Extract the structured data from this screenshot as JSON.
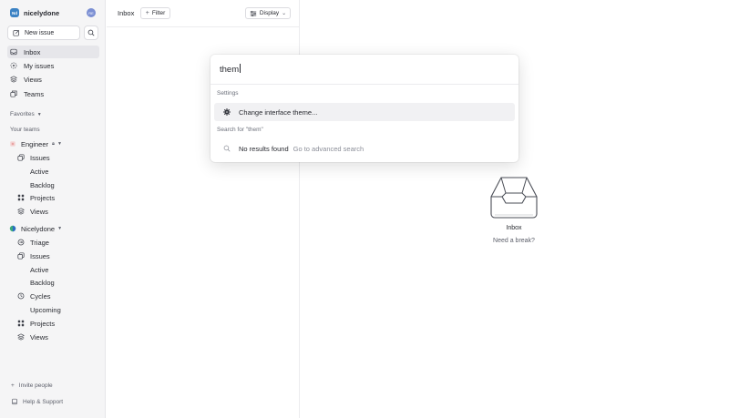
{
  "workspace": {
    "name": "nicelydone",
    "logo_text": "Nd",
    "avatar_text": "RE"
  },
  "sidebar": {
    "new_issue_label": "New issue",
    "nav": [
      {
        "label": "Inbox",
        "icon": "inbox-icon",
        "active": true
      },
      {
        "label": "My issues",
        "icon": "my-issues-icon"
      },
      {
        "label": "Views",
        "icon": "views-icon"
      },
      {
        "label": "Teams",
        "icon": "teams-icon"
      }
    ],
    "favorites_label": "Favorites",
    "your_teams_label": "Your teams",
    "teams": [
      {
        "name": "Engineer",
        "items": [
          {
            "label": "Issues",
            "icon": "issues-icon"
          },
          {
            "label": "Active",
            "nested": true
          },
          {
            "label": "Backlog",
            "nested": true
          },
          {
            "label": "Projects",
            "icon": "projects-icon"
          },
          {
            "label": "Views",
            "icon": "views-icon"
          }
        ]
      },
      {
        "name": "Nicelydone",
        "items": [
          {
            "label": "Triage",
            "icon": "triage-icon"
          },
          {
            "label": "Issues",
            "icon": "issues-icon"
          },
          {
            "label": "Active",
            "nested": true
          },
          {
            "label": "Backlog",
            "nested": true
          },
          {
            "label": "Cycles",
            "icon": "cycles-icon"
          },
          {
            "label": "Upcoming",
            "nested": true
          },
          {
            "label": "Projects",
            "icon": "projects-icon"
          },
          {
            "label": "Views",
            "icon": "views-icon"
          }
        ]
      }
    ],
    "invite_label": "Invite people",
    "help_label": "Help & Support"
  },
  "header": {
    "title": "Inbox",
    "filter_label": "Filter",
    "display_label": "Display"
  },
  "empty_state": {
    "title": "Inbox",
    "subtitle": "Need a break?"
  },
  "palette": {
    "query": "them",
    "group_settings": "Settings",
    "setting_result": "Change interface theme...",
    "group_search": "Search for \"them\"",
    "no_results": "No results found",
    "advanced_search": "Go to advanced search"
  },
  "colors": {
    "accent": "#3b82c4",
    "sidebar_bg": "#f5f5f6",
    "text": "#282a30",
    "muted": "#5c5f6a"
  }
}
